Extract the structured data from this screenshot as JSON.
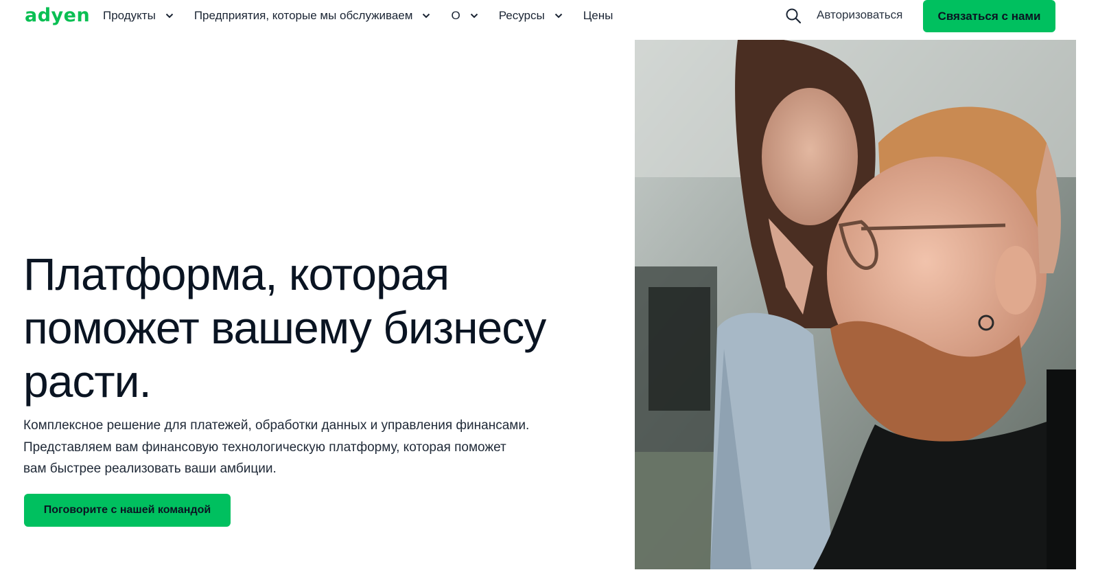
{
  "brand": {
    "logo_text": "adyen",
    "accent_color": "#00c05f"
  },
  "nav": {
    "items": [
      {
        "label": "Продукты",
        "has_dropdown": true
      },
      {
        "label": "Предприятия, которые мы обслуживаем",
        "has_dropdown": true
      },
      {
        "label": "О",
        "has_dropdown": true
      },
      {
        "label": "Ресурсы",
        "has_dropdown": true
      },
      {
        "label": "Цены",
        "has_dropdown": false
      }
    ],
    "search_icon": "search-icon",
    "login_label": "Авторизоваться",
    "contact_label": "Связаться с нами"
  },
  "hero": {
    "title": "Платформа, которая поможет вашему бизнесу расти.",
    "description": "Комплексное решение для платежей, обработки данных и управления финансами. Представляем вам финансовую технологическую платформу, которая поможет вам быстрее реализовать ваши амбиции.",
    "cta_label": "Поговорите с нашей командой"
  }
}
